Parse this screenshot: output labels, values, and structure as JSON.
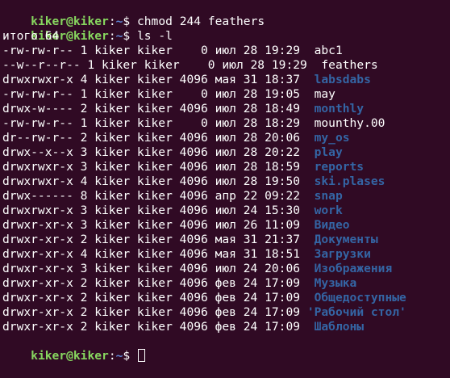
{
  "prompt": {
    "user": "kiker@kiker",
    "colon": ":",
    "path": "~",
    "symbol": "$ "
  },
  "commands": [
    "chmod 244 feathers",
    "ls -l"
  ],
  "total_line": "итого 64",
  "entries": [
    {
      "meta": "-rw-rw-r-- 1 kiker kiker    0 июл 28 19:29  ",
      "name": "abc1",
      "kind": "file"
    },
    {
      "meta": "--w--r--r-- 1 kiker kiker    0 июл 28 19:29  ",
      "name": "feathers",
      "kind": "file"
    },
    {
      "meta": "drwxrwxr-x 4 kiker kiker 4096 мая 31 18:37  ",
      "name": "labsdabs",
      "kind": "dir"
    },
    {
      "meta": "-rw-rw-r-- 1 kiker kiker    0 июл 28 19:05  ",
      "name": "may",
      "kind": "file"
    },
    {
      "meta": "drwx-w---- 2 kiker kiker 4096 июл 28 18:49  ",
      "name": "monthly",
      "kind": "dir"
    },
    {
      "meta": "-rw-rw-r-- 1 kiker kiker    0 июл 28 18:29  ",
      "name": "mounthy.00",
      "kind": "file"
    },
    {
      "meta": "dr--rw-r-- 2 kiker kiker 4096 июл 28 20:06  ",
      "name": "my_os",
      "kind": "dir"
    },
    {
      "meta": "drwx--x--x 3 kiker kiker 4096 июл 28 20:22  ",
      "name": "play",
      "kind": "dir"
    },
    {
      "meta": "drwxrwxr-x 3 kiker kiker 4096 июл 28 18:59  ",
      "name": "reports",
      "kind": "dir"
    },
    {
      "meta": "drwxrwxr-x 4 kiker kiker 4096 июл 28 19:50  ",
      "name": "ski.plases",
      "kind": "dir"
    },
    {
      "meta": "drwx------ 8 kiker kiker 4096 апр 22 09:22  ",
      "name": "snap",
      "kind": "dir"
    },
    {
      "meta": "drwxrwxr-x 3 kiker kiker 4096 июл 24 15:30  ",
      "name": "work",
      "kind": "dir"
    },
    {
      "meta": "drwxr-xr-x 3 kiker kiker 4096 июл 26 11:09  ",
      "name": "Видео",
      "kind": "dir"
    },
    {
      "meta": "drwxr-xr-x 2 kiker kiker 4096 мая 31 21:37  ",
      "name": "Документы",
      "kind": "dir"
    },
    {
      "meta": "drwxr-xr-x 4 kiker kiker 4096 мая 31 18:51  ",
      "name": "Загрузки",
      "kind": "dir"
    },
    {
      "meta": "drwxr-xr-x 3 kiker kiker 4096 июл 24 20:06  ",
      "name": "Изображения",
      "kind": "dir"
    },
    {
      "meta": "drwxr-xr-x 2 kiker kiker 4096 фев 24 17:09  ",
      "name": "Музыка",
      "kind": "dir"
    },
    {
      "meta": "drwxr-xr-x 2 kiker kiker 4096 фев 24 17:09  ",
      "name": "Общедоступные",
      "kind": "dir"
    },
    {
      "meta": "drwxr-xr-x 2 kiker kiker 4096 фев 24 17:09 ",
      "name": "'Рабочий стол'",
      "kind": "dir"
    },
    {
      "meta": "drwxr-xr-x 2 kiker kiker 4096 фев 24 17:09  ",
      "name": "Шаблоны",
      "kind": "dir"
    }
  ],
  "colors": {
    "background": "#300a24",
    "prompt_user": "#87d75f",
    "prompt_path": "#5f87d7",
    "directory": "#3465a4",
    "text": "#ffffff"
  }
}
